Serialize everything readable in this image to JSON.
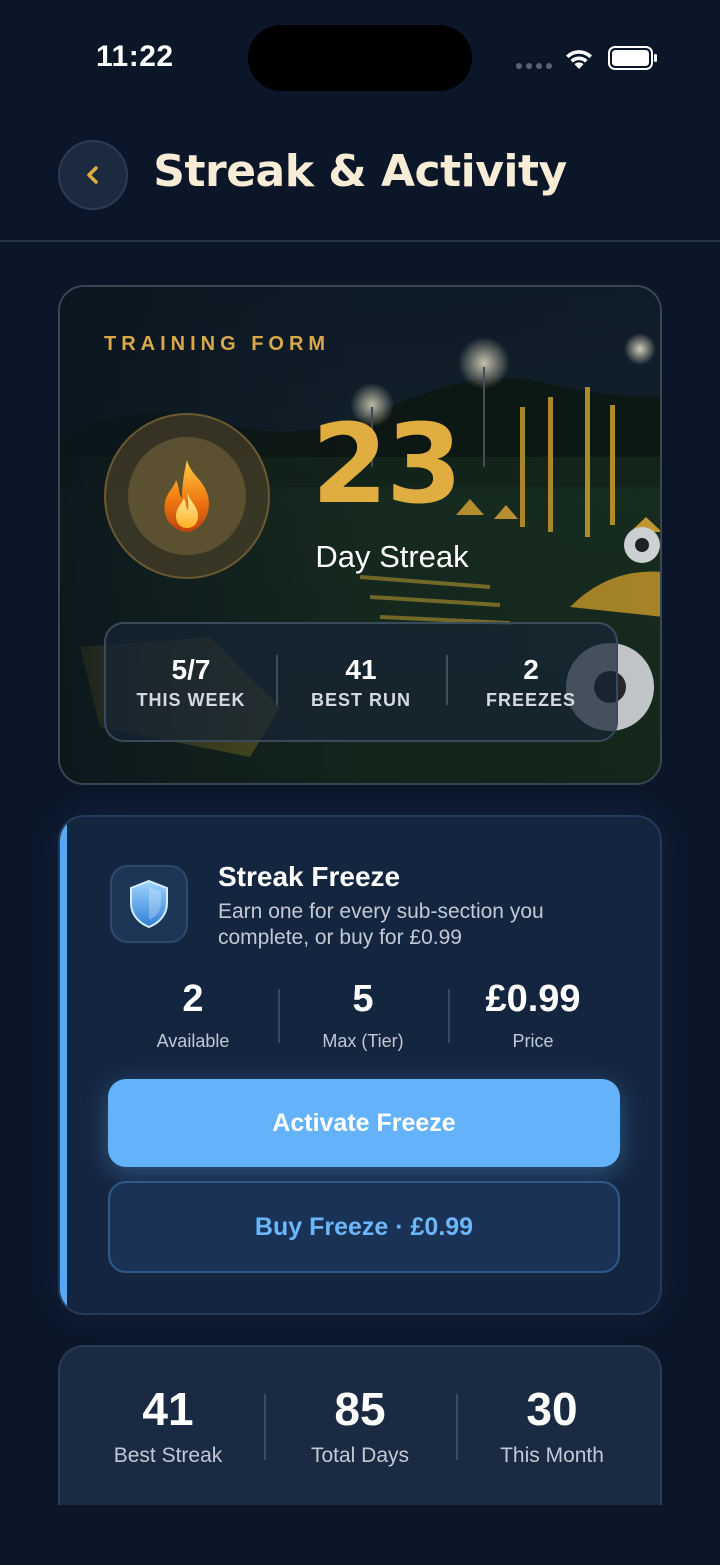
{
  "status_bar": {
    "time": "11:22"
  },
  "header": {
    "title": "Streak & Activity",
    "back_icon": "chevron-left-icon"
  },
  "training_form": {
    "eyebrow": "TRAINING FORM",
    "icon": "flame-icon",
    "streak_count": "23",
    "streak_label": "Day Streak",
    "stats": [
      {
        "value": "5/7",
        "label": "THIS WEEK"
      },
      {
        "value": "41",
        "label": "BEST RUN"
      },
      {
        "value": "2",
        "label": "FREEZES"
      }
    ]
  },
  "streak_freeze": {
    "icon": "shield-icon",
    "title": "Streak Freeze",
    "description": "Earn one for every sub-section you complete, or buy for £0.99",
    "stats": [
      {
        "value": "2",
        "label": "Available"
      },
      {
        "value": "5",
        "label": "Max (Tier)"
      },
      {
        "value": "£0.99",
        "label": "Price"
      }
    ],
    "activate_label": "Activate Freeze",
    "buy_label": "Buy Freeze · £0.99",
    "accent_color": "#5aa8f2"
  },
  "summary": {
    "stats": [
      {
        "value": "41",
        "label": "Best Streak"
      },
      {
        "value": "85",
        "label": "Total Days"
      },
      {
        "value": "30",
        "label": "This Month"
      }
    ]
  },
  "colors": {
    "background": "#0b1628",
    "gold": "#e0ad40",
    "primary_button": "#64b3fa"
  }
}
